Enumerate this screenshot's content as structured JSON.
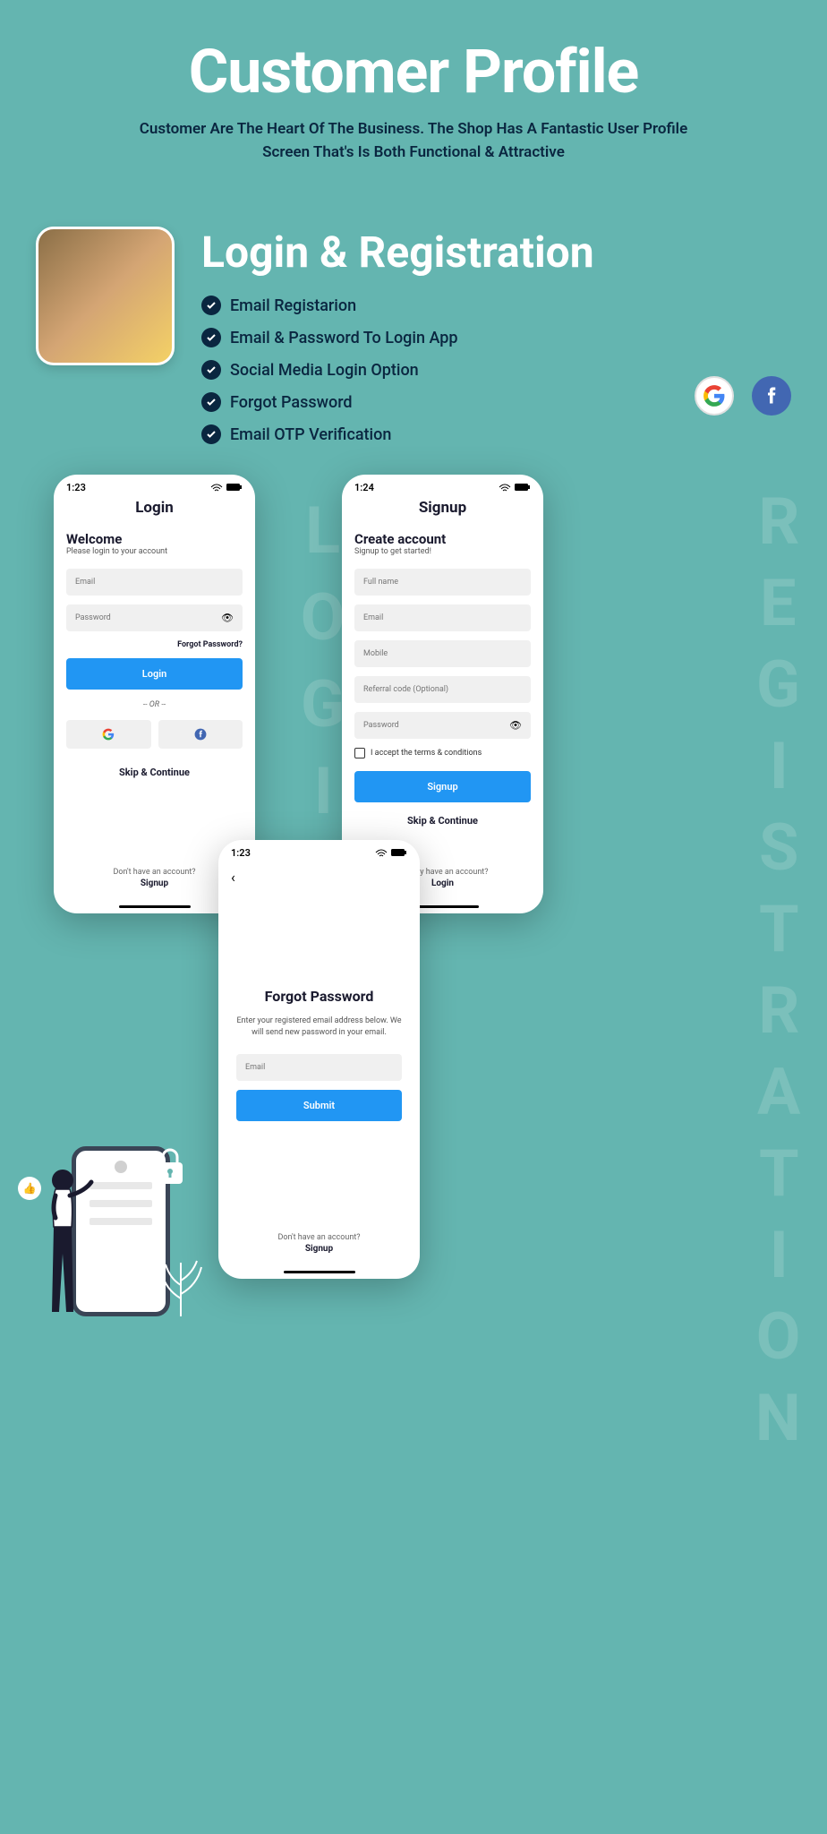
{
  "header": {
    "title": "Customer Profile",
    "subtitle": "Customer Are The Heart Of The Business. The Shop Has A Fantastic User Profile Screen That's Is Both Functional & Attractive"
  },
  "section": {
    "title": "Login & Registration",
    "features": [
      "Email Registarion",
      "Email & Password To Login App",
      "Social Media Login Option",
      "Forgot Password",
      "Email OTP Verification"
    ]
  },
  "bgText": {
    "login": "LOGIN",
    "registration": "REGISTRATION"
  },
  "loginScreen": {
    "time": "1:23",
    "title": "Login",
    "welcome": "Welcome",
    "welcomeSub": "Please login to your account",
    "emailPlaceholder": "Email",
    "passwordPlaceholder": "Password",
    "forgot": "Forgot Password?",
    "loginBtn": "Login",
    "or": "-- OR --",
    "skip": "Skip & Continue",
    "noAccount": "Don't have an account?",
    "signup": "Signup"
  },
  "signupScreen": {
    "time": "1:24",
    "title": "Signup",
    "createTitle": "Create account",
    "createSub": "Signup to get started!",
    "fullnamePlaceholder": "Full name",
    "emailPlaceholder": "Email",
    "mobilePlaceholder": "Mobile",
    "referralPlaceholder": "Referral code (Optional)",
    "passwordPlaceholder": "Password",
    "terms": "I accept the terms & conditions",
    "signupBtn": "Signup",
    "skip": "Skip & Continue",
    "haveAccount": "Already have an account?",
    "login": "Login"
  },
  "forgotScreen": {
    "time": "1:23",
    "title": "Forgot Password",
    "desc": "Enter your registered email address below. We will send new password in your email.",
    "emailPlaceholder": "Email",
    "submitBtn": "Submit",
    "noAccount": "Don't have an account?",
    "signup": "Signup"
  }
}
